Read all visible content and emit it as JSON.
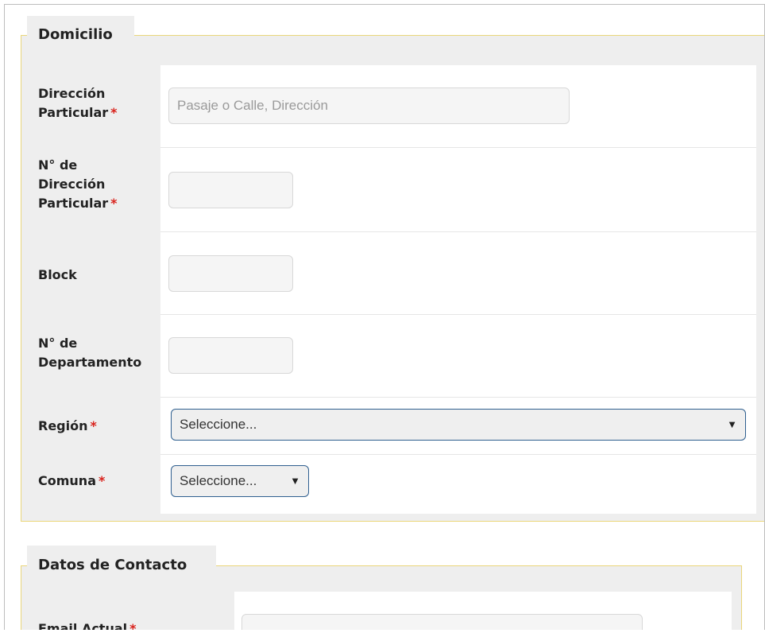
{
  "domicilio": {
    "legend": "Domicilio",
    "fields": {
      "direccion": {
        "label_line1": "Dirección",
        "label_line2": "Particular",
        "required": "*",
        "placeholder": "Pasaje o Calle, Dirección"
      },
      "numero": {
        "label_line1": "N° de",
        "label_line2": "Dirección",
        "label_line3": "Particular",
        "required": "*"
      },
      "block": {
        "label": "Block"
      },
      "departamento": {
        "label_line1": "N° de",
        "label_line2": "Departamento"
      },
      "region": {
        "label": "Región",
        "required": "*",
        "selected": "Seleccione...",
        "caret": "▼"
      },
      "comuna": {
        "label": "Comuna",
        "required": "*",
        "selected": "Seleccione...",
        "caret": "▼"
      }
    }
  },
  "contacto": {
    "legend": "Datos de Contacto",
    "fields": {
      "email": {
        "label": "Email Actual",
        "required": "*"
      }
    }
  },
  "colors": {
    "panel_bg": "#eeeeee",
    "panel_border": "#ead67a",
    "required": "#d9231d",
    "select_border": "#2f5f8f"
  }
}
